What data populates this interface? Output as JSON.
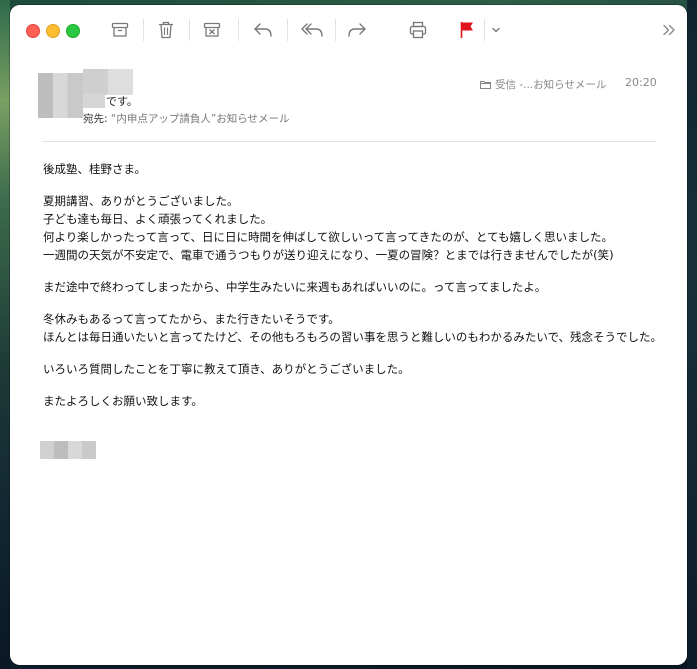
{
  "toolbar": {
    "buttons": [
      "archive-icon",
      "trash-icon",
      "junk-icon",
      "reply-icon",
      "reply-all-icon",
      "forward-icon",
      "print-icon",
      "flag-icon",
      "chevron-down-icon",
      "more-chevron-icon"
    ],
    "flag_color": "#e0161c"
  },
  "header": {
    "sender_suffix": "です。",
    "to_label": "宛先:",
    "to_value": "“内申点アップ請負人”お知らせメール",
    "mailbox": "受信 -...お知らせメール",
    "time": "20:20"
  },
  "body": {
    "greeting": "後成塾、桂野さま。",
    "para1": [
      "夏期講習、ありがとうございました。",
      "子ども達も毎日、よく頑張ってくれました。",
      "何より楽しかったって言って、日に日に時間を伸ばして欲しいって言ってきたのが、とても嬉しく思いました。",
      "一週間の天気が不安定で、電車で通うつもりが送り迎えになり、一夏の冒険？とまでは行きませんでしたが(笑)"
    ],
    "para2": "まだ途中で終わってしまったから、中学生みたいに来週もあればいいのに。って言ってましたよ。",
    "para3_line1": "冬休みもあるって言ってたから、また行きたいそうです。",
    "para3_line2": "ほんとは毎日通いたいと言ってたけど、その他もろもろの習い事を思うと難しいのもわかるみたいで、残念そうでした。",
    "para4": "いろいろ質問したことを丁寧に教えて頂き、ありがとうございました。",
    "closing": "またよろしくお願い致します。"
  }
}
